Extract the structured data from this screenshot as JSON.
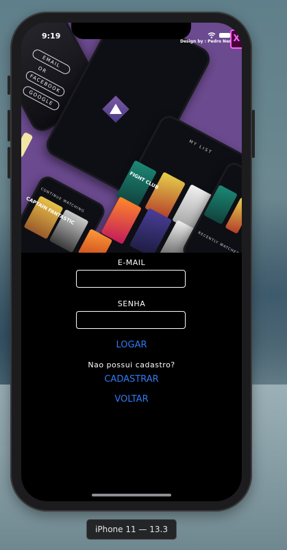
{
  "status": {
    "time": "9:19"
  },
  "hero": {
    "designer_credit": "Design by : Pedro Neres",
    "xd_badge": "Xd",
    "mock_buttons": [
      "EMAIL",
      "OR",
      "FACEBOOK",
      "GOOGLE"
    ],
    "mock_list_title": "MY LIST",
    "mock_poster_text": [
      "CAPTAIN FANTASTIC",
      "FIGHT CLUB",
      "CAPTAIN FANTASTIC"
    ],
    "mock_section_1": "CONTINUE WATCHING",
    "mock_section_2": "RECENTLY WATCHED"
  },
  "form": {
    "email_label": "E-MAIL",
    "email_value": "",
    "password_label": "SENHA",
    "password_value": "",
    "login_label": "LOGAR",
    "no_account_text": "Nao possui cadastro?",
    "register_label": "CADASTRAR",
    "back_label": "VOLTAR"
  },
  "simulator": {
    "device_label": "iPhone 11 — 13.3"
  },
  "colors": {
    "hero_bg": "#6b4a8f",
    "link": "#2f7cf6",
    "screen_bg": "#000000"
  }
}
